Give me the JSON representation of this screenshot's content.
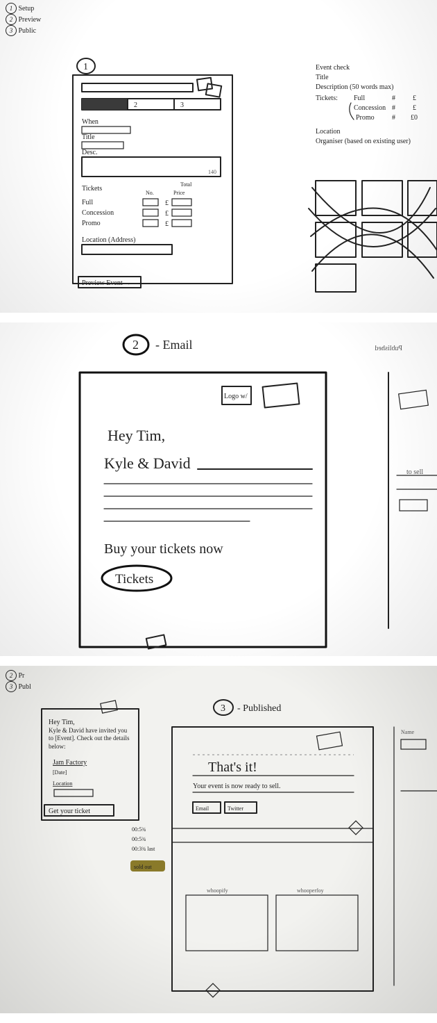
{
  "legend": {
    "items": [
      {
        "n": "1",
        "label": "Setup"
      },
      {
        "n": "2",
        "label": "Preview"
      },
      {
        "n": "3",
        "label": "Public"
      }
    ]
  },
  "panel1": {
    "stepCircle": "1",
    "stepper": [
      "1",
      "2",
      "3"
    ],
    "fields": {
      "when": "When",
      "title": "Title",
      "desc": "Desc."
    },
    "tickets": {
      "header": "Tickets",
      "cols": {
        "no": "No.",
        "price": "Price",
        "total": "Total"
      },
      "rows": [
        {
          "name": "Full",
          "price": "£"
        },
        {
          "name": "Concession",
          "price": "£"
        },
        {
          "name": "Promo",
          "price": "£"
        }
      ]
    },
    "location": "Location (Address)",
    "previewBtn": "Preview Event →",
    "notes": {
      "title": "Event check",
      "lines": [
        "Title",
        "Description (50 words max)"
      ],
      "ticketsLabel": "Tickets:",
      "ticketRows": [
        {
          "name": "Full",
          "hash": "#",
          "price": "£"
        },
        {
          "name": "Concession",
          "hash": "#",
          "price": "£"
        },
        {
          "name": "Promo",
          "hash": "#",
          "price": "£0"
        }
      ],
      "location": "Location",
      "organiser": "Organiser (based on existing user)"
    }
  },
  "panel2": {
    "stepCircle": "2",
    "stepLabel": "Email",
    "logoLabel": "Logo w/",
    "greeting": "Hey Tim,",
    "from": "Kyle & David",
    "cta": "Buy your tickets now",
    "button": "Tickets",
    "sideNote": "Published",
    "sideNote2": "to sell"
  },
  "panel3": {
    "legend": [
      {
        "n": "2",
        "label": "Pr"
      },
      {
        "n": "3",
        "label": "Publ"
      }
    ],
    "stepCircle": "3",
    "stepLabel": "Published",
    "card": {
      "greeting": "Hey Tim,",
      "body": "Kyle & David have invited you to [Event]. Check out the details below:",
      "venue": "Jam Factory",
      "date": "[Date]",
      "location": "Location",
      "button": "Get your ticket"
    },
    "published": {
      "headline": "That's it!",
      "sub": "Your event is now ready to sell.",
      "share": [
        "Email",
        "Twitter"
      ],
      "sold": "sold out",
      "rightNote": "Name"
    },
    "rulers": [
      "00:5¾",
      "00:5¾",
      "00:3¾",
      "last"
    ],
    "timeline": [
      "whoopify",
      "whooperfoy"
    ]
  }
}
